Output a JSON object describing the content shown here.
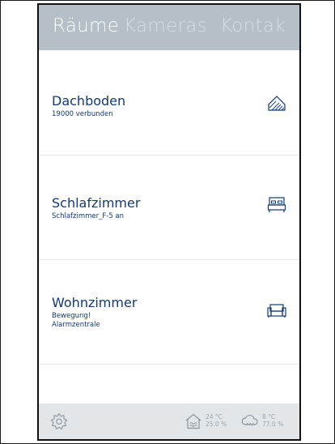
{
  "tabs": [
    {
      "label": "Räume",
      "active": true
    },
    {
      "label": "Kameras",
      "active": false
    },
    {
      "label": "Kontak",
      "active": false
    }
  ],
  "rooms": [
    {
      "name": "Dachboden",
      "status": [
        "19000 verbunden"
      ],
      "icon": "attic-icon"
    },
    {
      "name": "Schlafzimmer",
      "status": [
        "Schlafzimmer_F-5 an"
      ],
      "icon": "bed-icon"
    },
    {
      "name": "Wohnzimmer",
      "status": [
        "Bewegung!",
        "Alarmzentrale"
      ],
      "icon": "sofa-icon"
    }
  ],
  "footer": {
    "settings_icon": "gear-icon",
    "indoor": {
      "icon": "house-heat-icon",
      "temperature": "24 °C",
      "humidity": "25.0 %"
    },
    "outdoor": {
      "icon": "cloud-rain-icon",
      "temperature": "8 °C",
      "humidity": "77.0 %"
    }
  },
  "colors": {
    "header_bg": "#b4bfc7",
    "room_text": "#123a73",
    "footer_bg": "#e3e6e9"
  }
}
